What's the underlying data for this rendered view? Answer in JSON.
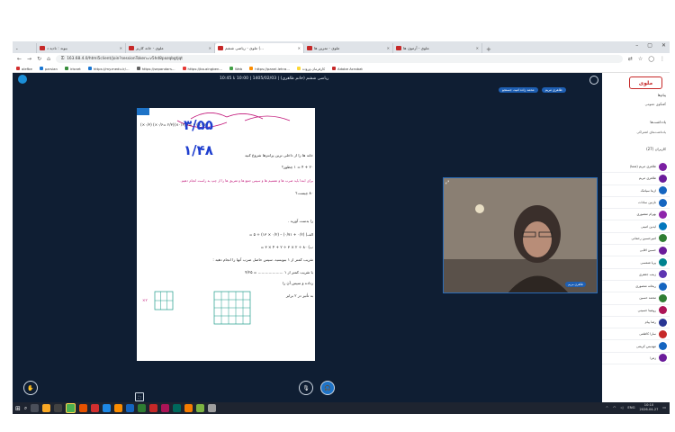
{
  "browser": {
    "tabs": [
      {
        "title": "بیوند : نادیه د",
        "active": false
      },
      {
        "title": "ملوی - خانه کاربر",
        "active": false
      },
      {
        "title": "ملوی - ریاضی ششم (...",
        "active": true
      },
      {
        "title": "ملوی - تمرین ها",
        "active": false
      },
      {
        "title": "ملوی - آزمون ها",
        "active": false
      }
    ],
    "new_tab": "+",
    "window_controls": [
      "–",
      "▢",
      "✕"
    ],
    "url": "163.68.4.0/html5client/join?sessionToken=v5hd8pazqbgtjqt",
    "bookmarks": [
      "alefbe",
      "parsian",
      "irisnet",
      "https://my.medu.ir/...",
      "https://sepandars...",
      "https://bo.aingben...",
      "Web",
      "https://panel.lehra...",
      "کارفرمان وروده",
      "Adobe Acrobat"
    ]
  },
  "meeting": {
    "title": "ریاضی ششم (خانم طاهری) | 1405/02/03 | 10:00 تا 10:45",
    "chips": [
      "طاهری مریم",
      "محمد زاده امید، جستجو"
    ],
    "board_lines": [
      "(۰/۲×) ۳ =۲ (۰/۶×)(۲/۳ =۰/۶×) (۰/۳×)",
      "۳/۵۵",
      "۱/۴۸",
      "خانه ها را از داخلی ترین پرانتزها شروع کنید",
      "۲۰ + ۴ = ۱ چطور؟",
      "برای ابتدا باید ضرب ها و تقسیم ها و سپس جمع ها و تفریق ها را از چپ به راست انجام دهیم.",
      "۸۰ چیست؟",
      "را بدست آورید .",
      "الف) (۰/۲ + ۰/۷۱) – (۰/۲ × ۱۳) ÷ ۵ =",
      "ب) ۸۰ ÷ ۲ × ۳ ÷ ۲ + ۴ × ۳ =",
      "تقریب کمتر از ۱ بنویسید. سپس حاصل ضرب آنها را انجام دهید :",
      "با تقریب کمتر از ۱ ..................... = ۴/۲۵",
      "رداده و سپس آن را",
      "به تأثیر در ۲ برابر",
      "۲×"
    ],
    "video_name": "طاهری مریم"
  },
  "sidebar": {
    "brand": "ملوی",
    "messages_title": "پیام‌ها",
    "group_chat": "گفتگوی عمومی",
    "notes_title": "یادداشت‌ها",
    "shared_notes": "یادداشت‌های اشتراکی",
    "participants_title": "کاربران (27)",
    "participants": [
      {
        "name": "طاهری مریم (شما)",
        "color": "#7b1fa2"
      },
      {
        "name": "طاهری مریم",
        "color": "#6a1b9a"
      },
      {
        "name": "آزیتا سیامک",
        "color": "#1565c0"
      },
      {
        "name": "نازنین سادات",
        "color": "#1565c0"
      },
      {
        "name": "بهرام منصوری",
        "color": "#8e24aa"
      },
      {
        "name": "آیدین امینی",
        "color": "#0277bd"
      },
      {
        "name": "امیرحسین رحمانی",
        "color": "#2e7d32"
      },
      {
        "name": "حسین آقایی",
        "color": "#6a1b9a"
      },
      {
        "name": "پریا شمسی",
        "color": "#00838f"
      },
      {
        "name": "زینب جعفری",
        "color": "#5e35b1"
      },
      {
        "name": "ریحانه منصوری",
        "color": "#1565c0"
      },
      {
        "name": "محمد حسین",
        "color": "#2e7d32"
      },
      {
        "name": "روهینا حسینی",
        "color": "#ad1457"
      },
      {
        "name": "رضا پیام",
        "color": "#283593"
      },
      {
        "name": "سارا کاظمی",
        "color": "#c62828"
      },
      {
        "name": "مهدیس کریمی",
        "color": "#1565c0"
      },
      {
        "name": "زهرا",
        "color": "#6a1b9a"
      }
    ]
  },
  "taskbar": {
    "lang": "ENG",
    "time": "10:10",
    "date": "2026-04-27"
  }
}
